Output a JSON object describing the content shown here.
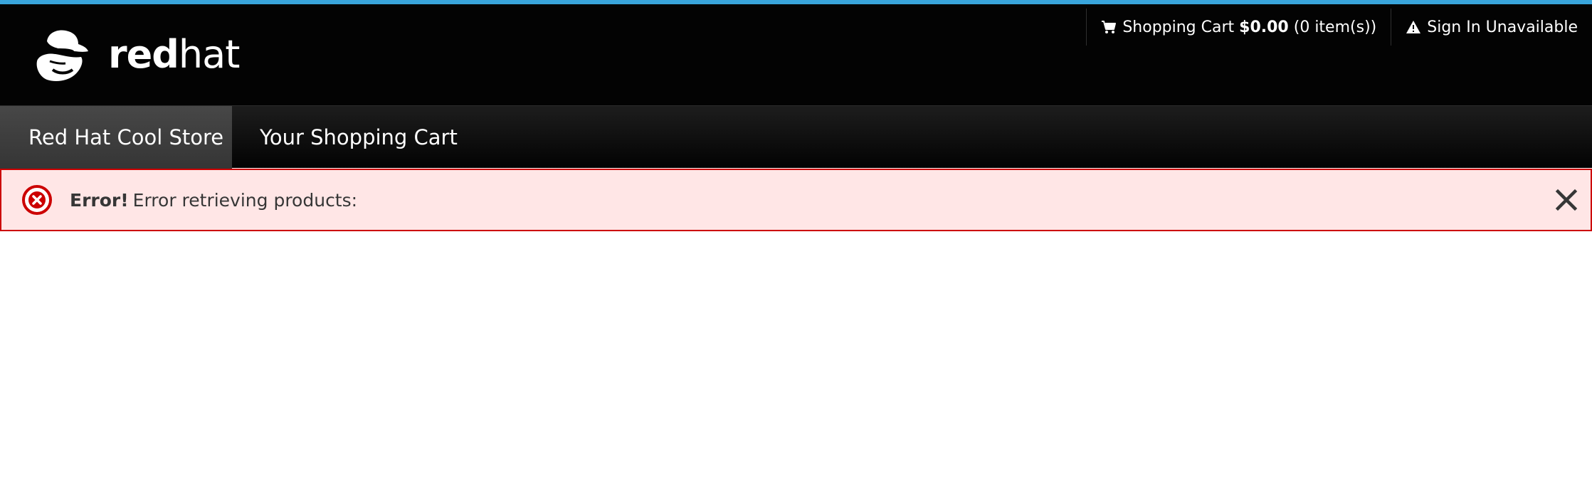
{
  "brand": {
    "logo_red": "red",
    "logo_hat": "hat",
    "accent_color": "#39a5dc",
    "logo_icon": "redhat-shadowman-icon"
  },
  "utility_nav": {
    "cart_label": "Shopping Cart",
    "cart_total": "$0.00",
    "cart_count": "(0 item(s))",
    "cart_icon": "cart-icon",
    "signin_label": "Sign In Unavailable",
    "signin_icon": "warning-icon"
  },
  "primary_nav": {
    "items": [
      {
        "label": "Red Hat Cool Store",
        "active": true
      },
      {
        "label": "Your Shopping Cart",
        "active": false
      }
    ]
  },
  "alert": {
    "title": "Error!",
    "message": "Error retrieving products:",
    "icon": "error-circle-icon",
    "close_icon": "close-icon",
    "background": "#ffe6e6",
    "border_color": "#cc0000"
  }
}
